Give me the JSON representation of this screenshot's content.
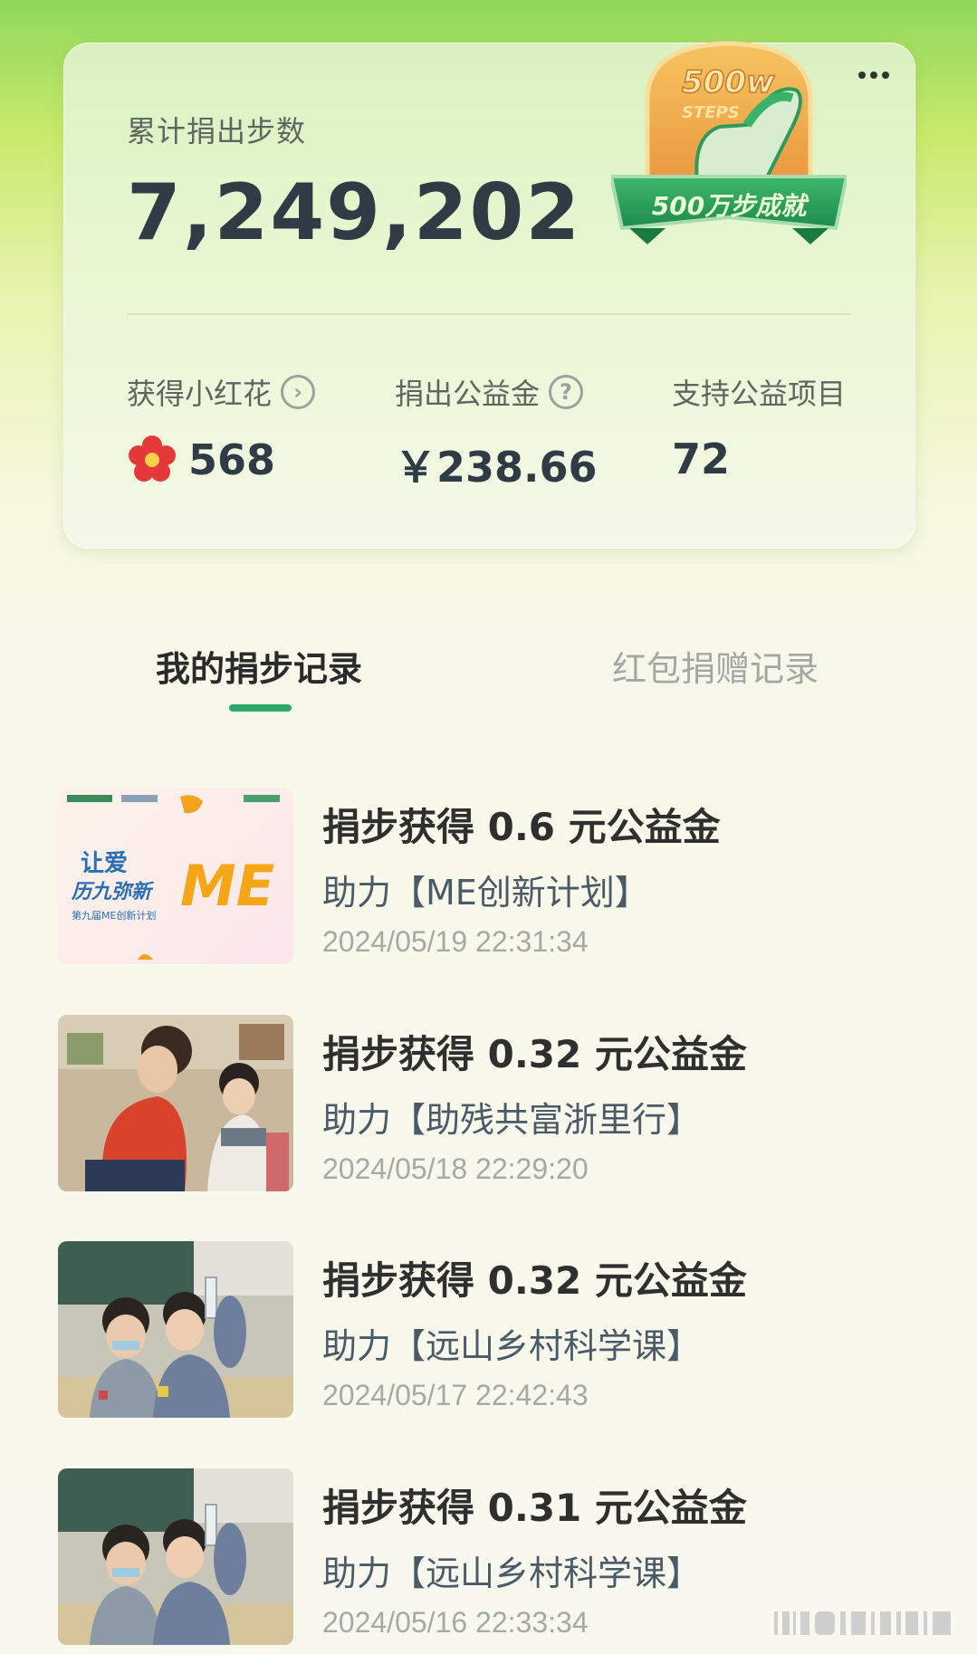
{
  "summary": {
    "total_label": "累计捐出步数",
    "total_value": "7,249,202",
    "badge": {
      "top_text": "500w",
      "sub_text": "STEPS",
      "ribbon_text": "500万步成就"
    },
    "stats": [
      {
        "label": "获得小红花",
        "value": "568",
        "icon": "chevron-right-circle-icon"
      },
      {
        "label": "捐出公益金",
        "value": "￥238.66",
        "icon": "question-circle-icon"
      },
      {
        "label": "支持公益项目",
        "value": "72"
      }
    ]
  },
  "tabs": [
    {
      "label": "我的捐步记录",
      "active": true
    },
    {
      "label": "红包捐赠记录",
      "active": false
    }
  ],
  "records": [
    {
      "title": "捐步获得 0.6 元公益金",
      "project": "助力【ME创新计划】",
      "time": "2024/05/19 22:31:34",
      "thumb": {
        "line1": "让爱",
        "line2": "历九弥新",
        "line3": "第九届ME创新计划",
        "logo": "ME"
      }
    },
    {
      "title": "捐步获得 0.32 元公益金",
      "project": "助力【助残共富浙里行】",
      "time": "2024/05/18 22:29:20"
    },
    {
      "title": "捐步获得 0.32 元公益金",
      "project": "助力【远山乡村科学课】",
      "time": "2024/05/17 22:42:43"
    },
    {
      "title": "捐步获得 0.31 元公益金",
      "project": "助力【远山乡村科学课】",
      "time": "2024/05/16 22:33:34"
    }
  ],
  "colors": {
    "accent": "#2fa66a",
    "text_dark": "#2f3b45",
    "text_muted": "#a6aaa6",
    "project_text": "#4a5a66"
  }
}
